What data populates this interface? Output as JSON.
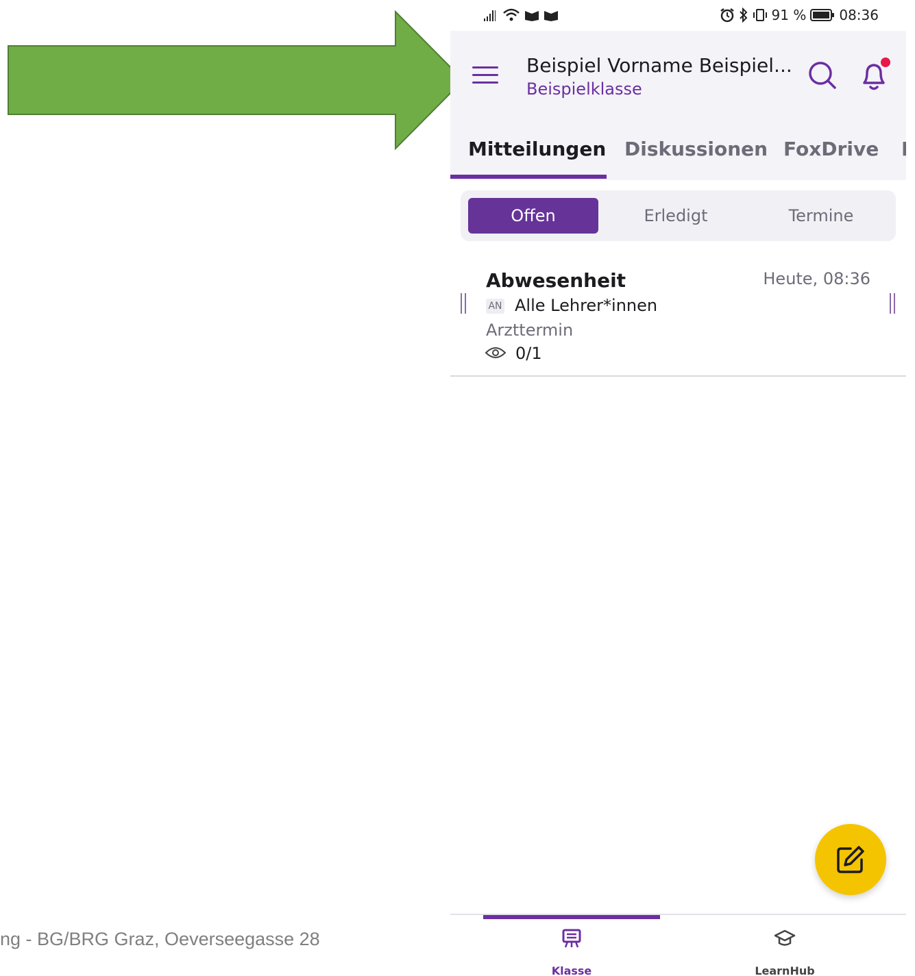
{
  "slide": {
    "footer_text": "ng  -  BG/BRG Graz, Oeverseegasse 28",
    "arrow_color": "#70ad47"
  },
  "status_bar": {
    "battery_percent": "91 %",
    "time": "08:36",
    "icons": [
      "signal-icon",
      "wifi-icon",
      "notification-icon",
      "notification-icon",
      "alarm-icon",
      "bluetooth-icon",
      "vibrate-icon",
      "battery-icon"
    ]
  },
  "header": {
    "title": "Beispiel Vorname Beispiel...",
    "subtitle": "Beispielklasse",
    "icons": [
      "menu-icon",
      "search-icon",
      "bell-icon"
    ],
    "notification_dot_color": "#e8174a"
  },
  "tabs": [
    {
      "label": "Mitteilungen",
      "active": true
    },
    {
      "label": "Diskussionen",
      "active": false
    },
    {
      "label": "FoxDrive",
      "active": false
    },
    {
      "label": "F",
      "active": false
    }
  ],
  "filter": {
    "options": [
      {
        "label": "Offen",
        "selected": true
      },
      {
        "label": "Erledigt",
        "selected": false
      },
      {
        "label": "Termine",
        "selected": false
      }
    ]
  },
  "messages": [
    {
      "title": "Abwesenheit",
      "time": "Heute, 08:36",
      "to_badge": "AN",
      "recipient": "Alle Lehrer*innen",
      "preview": "Arzttermin",
      "read_count": "0/1"
    }
  ],
  "fab": {
    "icon": "edit-icon",
    "color": "#f5c400"
  },
  "bottom_nav": [
    {
      "label": "Klasse",
      "icon": "presentation-icon",
      "active": true
    },
    {
      "label": "LearnHub",
      "icon": "graduation-cap-icon",
      "active": false
    }
  ],
  "colors": {
    "accent": "#6b2fa0",
    "segment_selected": "#663399"
  }
}
